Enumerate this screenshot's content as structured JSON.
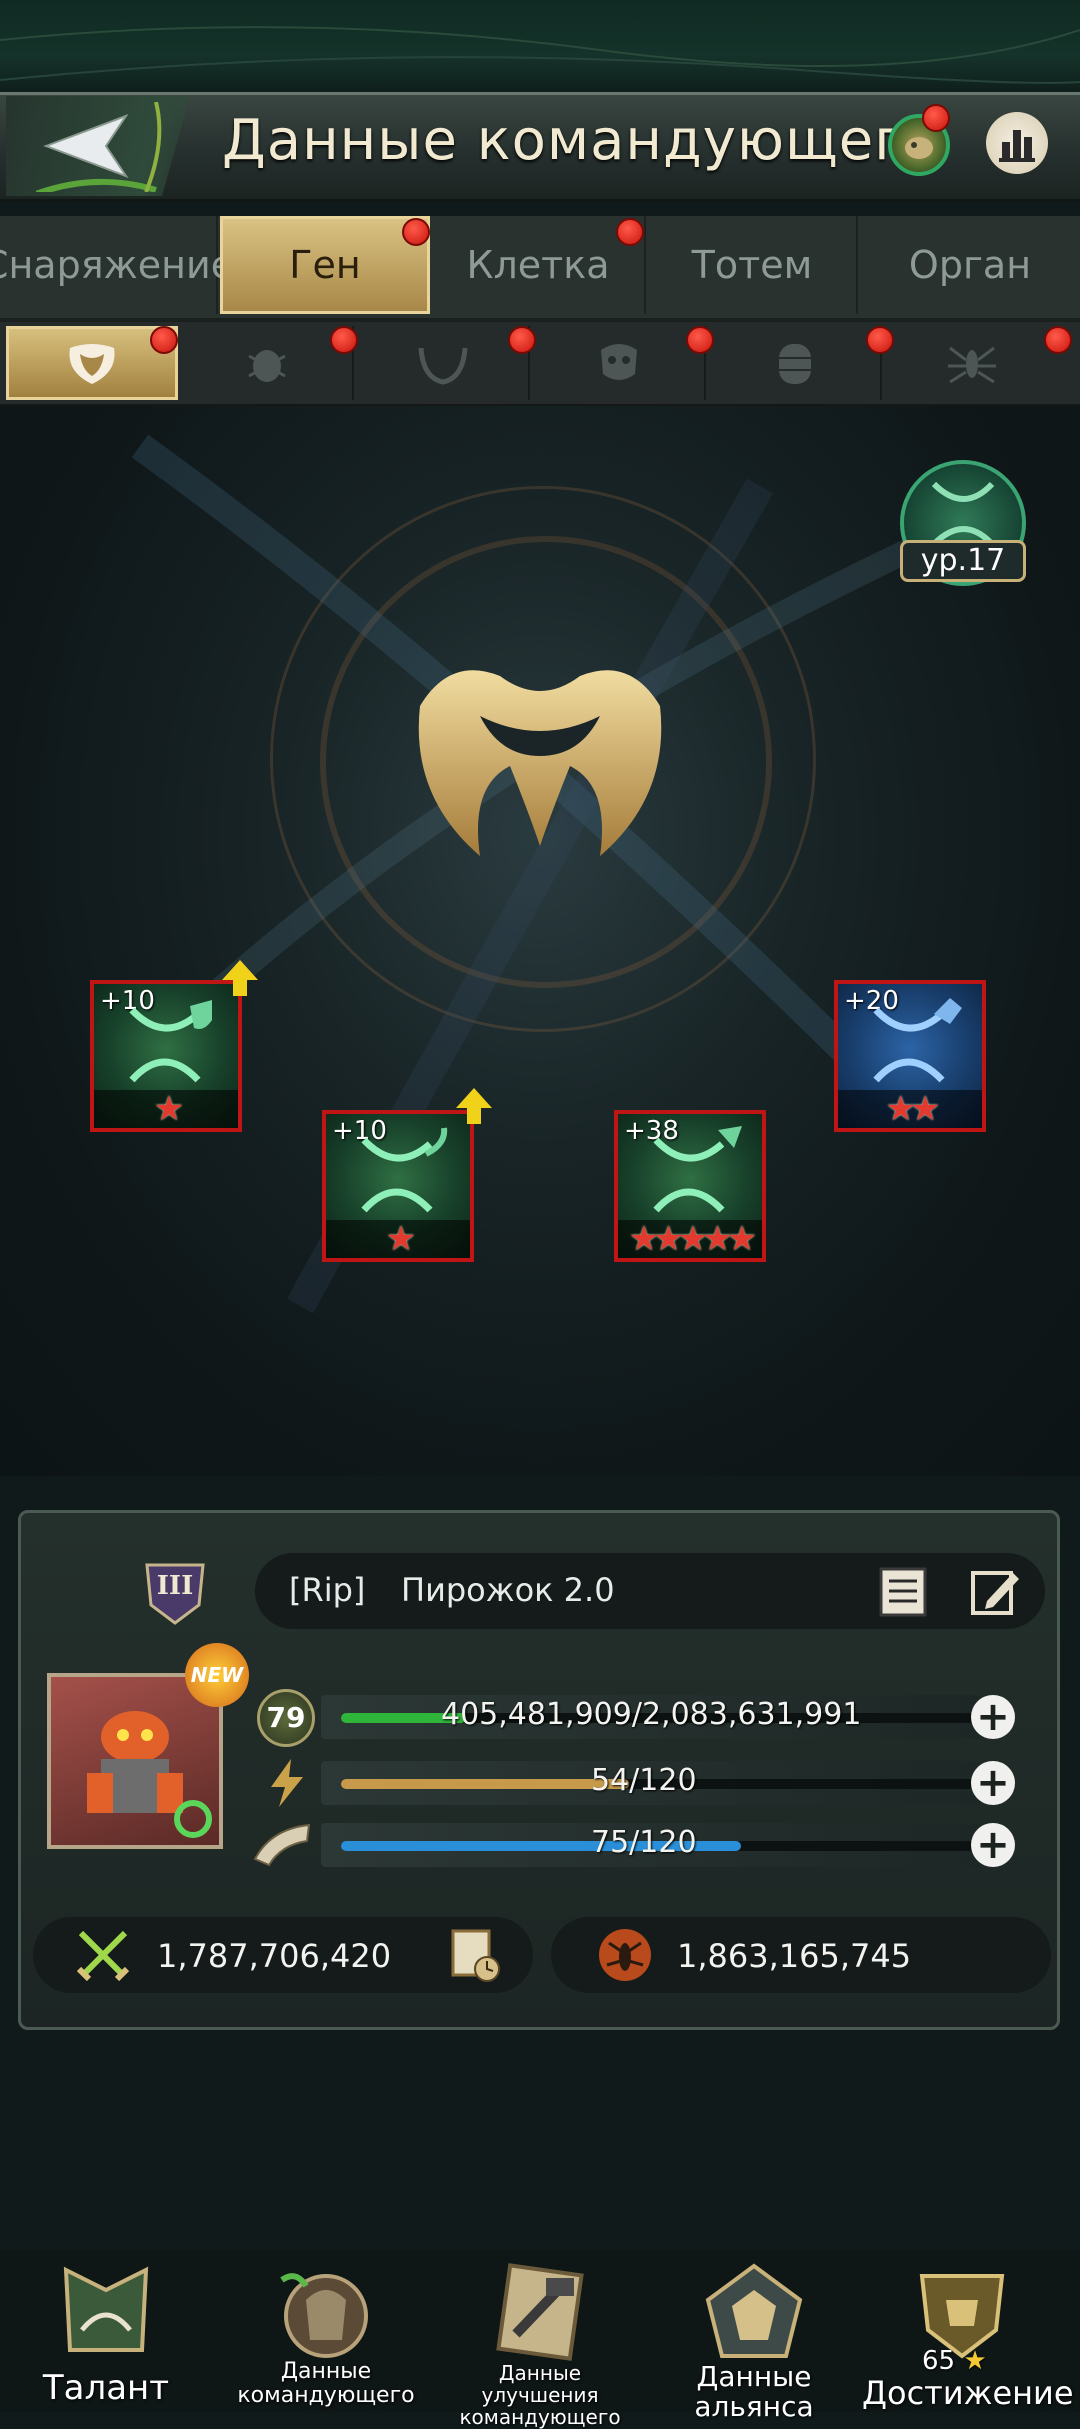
{
  "header": {
    "title": "Данные командующего"
  },
  "main_tabs": [
    {
      "label": "Снаряжение",
      "active": false
    },
    {
      "label": "Ген",
      "active": true
    },
    {
      "label": "Клетка",
      "active": false
    },
    {
      "label": "Тотем",
      "active": false
    },
    {
      "label": "Орган",
      "active": false
    }
  ],
  "sub_tabs": [
    {
      "icon": "gene-emblem-icon",
      "active": true
    },
    {
      "icon": "beetle-icon"
    },
    {
      "icon": "mandible-icon"
    },
    {
      "icon": "skull-icon"
    },
    {
      "icon": "larva-icon"
    },
    {
      "icon": "ant-icon"
    }
  ],
  "gene_level": {
    "label": "ур.17"
  },
  "gene_cards": [
    {
      "level": "+10",
      "stars": 1,
      "color": "green",
      "upgrade_arrow": true
    },
    {
      "level": "+10",
      "stars": 1,
      "color": "green",
      "upgrade_arrow": true
    },
    {
      "level": "+38",
      "stars": 5,
      "color": "green",
      "upgrade_arrow": false
    },
    {
      "level": "+20",
      "stars": 2,
      "color": "blue",
      "upgrade_arrow": false
    }
  ],
  "commander": {
    "rank_badge": "III",
    "alliance_tag": "[Rip]",
    "name": "Пирожок 2.0",
    "avatar_badge": "NEW",
    "level": "79",
    "hp_text": "405,481,909/2,083,631,991",
    "hp_fraction": 0.195,
    "stamina_text": "54/120",
    "stamina_fraction": 0.45,
    "horn_text": "75/120",
    "horn_fraction": 0.625,
    "power": "1,787,706,420",
    "kills": "1,863,165,745"
  },
  "bottom_nav": [
    {
      "label": "Талант"
    },
    {
      "label": "Данные командующего"
    },
    {
      "label": "Данные улучшения командующего"
    },
    {
      "label": "Данные альянса"
    },
    {
      "label": "Достижение",
      "badge": "65"
    }
  ],
  "colors": {
    "gold": "#d7bf7d",
    "red_dot": "#e0261c",
    "hp_bar": "#2fb53a",
    "stamina_bar": "#c69a4a",
    "horn_bar": "#2a8fd8"
  }
}
